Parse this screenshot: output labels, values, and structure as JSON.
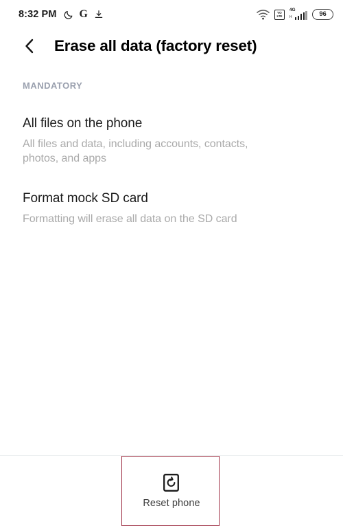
{
  "status_bar": {
    "time": "8:32 PM",
    "left_icons": [
      {
        "name": "dark-mode-moon-icon",
        "glyph": "moon"
      },
      {
        "name": "google-g-icon",
        "glyph": "G"
      },
      {
        "name": "download-icon",
        "glyph": "download"
      }
    ],
    "right_icons": [
      {
        "name": "wifi-icon"
      },
      {
        "name": "volte-icon",
        "line1": "VO",
        "line2": "LTE"
      },
      {
        "name": "mobile-signal-icon",
        "network": "4G",
        "sub": "H"
      }
    ],
    "battery": {
      "level": "96"
    }
  },
  "app_bar": {
    "back_label": "Back",
    "title": "Erase all data (factory reset)"
  },
  "content": {
    "section_label": "MANDATORY",
    "items": [
      {
        "title": "All files on the phone",
        "summary": "All files and data, including accounts, contacts, photos, and apps"
      },
      {
        "title": "Format mock SD card",
        "summary": "Formatting will erase all data on the SD card"
      }
    ]
  },
  "bottom_bar": {
    "reset_label": "Reset phone",
    "reset_icon": "reset-phone-icon"
  },
  "colors": {
    "background": "#ffffff",
    "title_text": "#000000",
    "section_label": "#9aa0ae",
    "summary_text": "#a9a9a9",
    "divider": "#eceff1",
    "highlight_border": "#9e2f43"
  }
}
